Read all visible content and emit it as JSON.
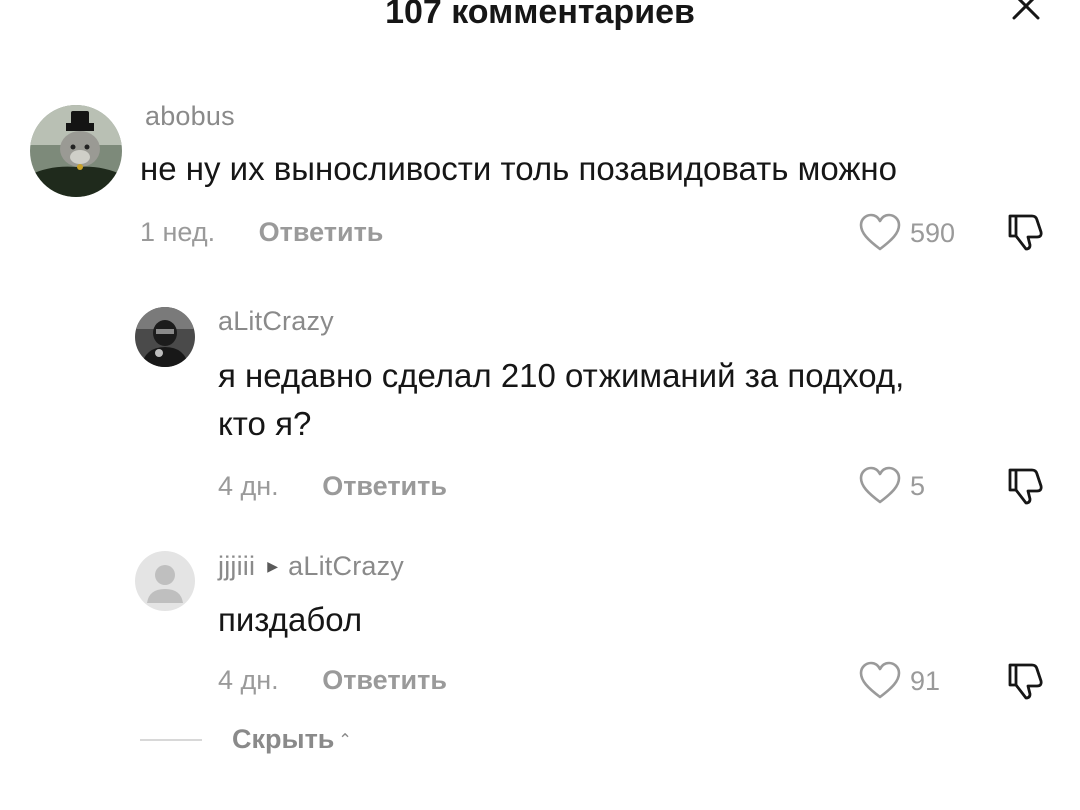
{
  "header": {
    "title": "107 комментариев",
    "close_icon": "close-icon"
  },
  "comments": [
    {
      "username": "abobus",
      "text": "не ну их выносливости толь позавидовать можно",
      "time": "1 нед.",
      "reply_label": "Ответить",
      "likes": "590",
      "avatar": "cat-avatar"
    },
    {
      "username": "aLitCrazy",
      "text_line1": "я недавно сделал 210 отжиманий за подход,",
      "text_line2": "кто я?",
      "time": "4 дн.",
      "reply_label": "Ответить",
      "likes": "5",
      "avatar": "person-avatar"
    },
    {
      "username": "jjjiii",
      "reply_to": "aLitCrazy",
      "text": "пиздабол",
      "time": "4 дн.",
      "reply_label": "Ответить",
      "likes": "91",
      "avatar": "default-avatar"
    }
  ],
  "footer": {
    "hide_label": "Скрыть"
  },
  "colors": {
    "text": "#161616",
    "muted": "#8a8a8a",
    "background": "#ffffff"
  }
}
